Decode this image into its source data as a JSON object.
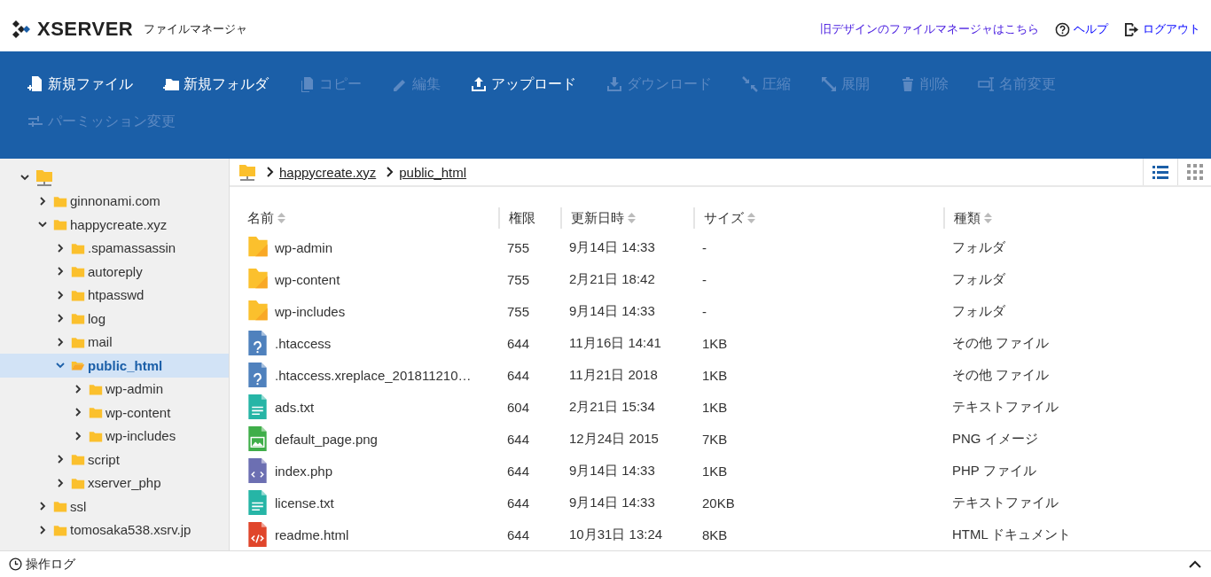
{
  "header": {
    "logo": "XSERVER",
    "app_title": "ファイルマネージャ",
    "links": [
      {
        "label": "旧デザインのファイルマネージャはこちら",
        "kind": "plain"
      },
      {
        "label": "ヘルプ",
        "kind": "help"
      },
      {
        "label": "ログアウト",
        "kind": "logout"
      }
    ]
  },
  "toolbar": [
    {
      "label": "新規ファイル",
      "kind": "new-file",
      "disabled": false
    },
    {
      "label": "新規フォルダ",
      "kind": "new-folder",
      "disabled": false
    },
    {
      "label": "コピー",
      "kind": "copy",
      "disabled": true
    },
    {
      "label": "編集",
      "kind": "edit",
      "disabled": true
    },
    {
      "label": "アップロード",
      "kind": "upload",
      "disabled": false
    },
    {
      "label": "ダウンロード",
      "kind": "download",
      "disabled": true
    },
    {
      "label": "圧縮",
      "kind": "compress",
      "disabled": true
    },
    {
      "label": "展開",
      "kind": "expand",
      "disabled": true
    },
    {
      "label": "削除",
      "kind": "delete",
      "disabled": true
    },
    {
      "label": "名前変更",
      "kind": "rename",
      "disabled": true
    },
    {
      "label": "パーミッション変更",
      "kind": "permission",
      "disabled": true
    }
  ],
  "tree": [
    {
      "expanded": true,
      "selected": false,
      "children": [
        {
          "label": "ginnonami.com",
          "expanded": false,
          "selected": false
        },
        {
          "label": "happycreate.xyz",
          "expanded": true,
          "selected": false,
          "children": [
            {
              "label": ".spamassassin",
              "expanded": false,
              "selected": false
            },
            {
              "label": "autoreply",
              "expanded": false,
              "selected": false
            },
            {
              "label": "htpasswd",
              "expanded": false,
              "selected": false
            },
            {
              "label": "log",
              "expanded": false,
              "selected": false
            },
            {
              "label": "mail",
              "expanded": false,
              "selected": false
            },
            {
              "label": "public_html",
              "expanded": true,
              "selected": true,
              "children": [
                {
                  "label": "wp-admin",
                  "expanded": false,
                  "selected": false
                },
                {
                  "label": "wp-content",
                  "expanded": false,
                  "selected": false
                },
                {
                  "label": "wp-includes",
                  "expanded": false,
                  "selected": false
                }
              ]
            },
            {
              "label": "script",
              "expanded": false,
              "selected": false
            },
            {
              "label": "xserver_php",
              "expanded": false,
              "selected": false
            }
          ]
        },
        {
          "label": "ssl",
          "expanded": false,
          "selected": false
        },
        {
          "label": "tomosaka538.xsrv.jp",
          "expanded": false,
          "selected": false
        }
      ]
    }
  ],
  "breadcrumb": [
    "happycreate.xyz",
    "public_html"
  ],
  "view_modes": [
    {
      "kind": "list",
      "selected": true
    },
    {
      "kind": "grid",
      "selected": false
    }
  ],
  "table": {
    "columns": [
      {
        "label": "名前",
        "sortable": true
      },
      {
        "label": "権限",
        "sortable": false
      },
      {
        "label": "更新日時",
        "sortable": true
      },
      {
        "label": "サイズ",
        "sortable": true
      },
      {
        "label": "種類",
        "sortable": true
      }
    ],
    "rows": [
      {
        "kind": "folder",
        "cells": [
          "wp-admin",
          "755",
          "9月14日 14:33",
          "-",
          "フォルダ"
        ]
      },
      {
        "kind": "folder",
        "cells": [
          "wp-content",
          "755",
          "2月21日 18:42",
          "-",
          "フォルダ"
        ]
      },
      {
        "kind": "folder",
        "cells": [
          "wp-includes",
          "755",
          "9月14日 14:33",
          "-",
          "フォルダ"
        ]
      },
      {
        "kind": "unknown",
        "cells": [
          ".htaccess",
          "644",
          "11月16日 14:41",
          "1KB",
          "その他 ファイル"
        ]
      },
      {
        "kind": "unknown",
        "cells": [
          ".htaccess.xreplace_201811210…",
          "644",
          "11月21日 2018",
          "1KB",
          "その他 ファイル"
        ]
      },
      {
        "kind": "text",
        "cells": [
          "ads.txt",
          "604",
          "2月21日 15:34",
          "1KB",
          "テキストファイル"
        ]
      },
      {
        "kind": "image",
        "cells": [
          "default_page.png",
          "644",
          "12月24日 2015",
          "7KB",
          "PNG イメージ"
        ]
      },
      {
        "kind": "php",
        "cells": [
          "index.php",
          "644",
          "9月14日 14:33",
          "1KB",
          "PHP ファイル"
        ]
      },
      {
        "kind": "text",
        "cells": [
          "license.txt",
          "644",
          "9月14日 14:33",
          "20KB",
          "テキストファイル"
        ]
      },
      {
        "kind": "html",
        "cells": [
          "readme.html",
          "644",
          "10月31日 13:24",
          "8KB",
          "HTML ドキュメント"
        ]
      }
    ]
  },
  "footer": {
    "label": "操作ログ"
  }
}
